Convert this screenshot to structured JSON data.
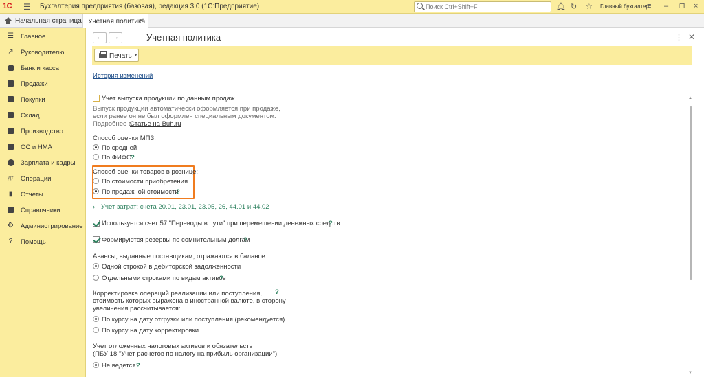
{
  "titlebar": {
    "logo": "1С",
    "app_title": "Бухгалтерия предприятия (базовая), редакция 3.0  (1С:Предприятие)",
    "search_placeholder": "Поиск Ctrl+Shift+F",
    "user": "Главный бухгалтер"
  },
  "tabs": {
    "home": "Начальная страница",
    "active": "Учетная политика"
  },
  "sidebar": {
    "items": [
      {
        "label": "Главное",
        "icon": "menu-icon"
      },
      {
        "label": "Руководителю",
        "icon": "chart-icon"
      },
      {
        "label": "Банк и касса",
        "icon": "coin-icon"
      },
      {
        "label": "Продажи",
        "icon": "bag-icon"
      },
      {
        "label": "Покупки",
        "icon": "cart-icon"
      },
      {
        "label": "Склад",
        "icon": "box-icon"
      },
      {
        "label": "Производство",
        "icon": "factory-icon"
      },
      {
        "label": "ОС и НМА",
        "icon": "truck-icon"
      },
      {
        "label": "Зарплата и кадры",
        "icon": "person-icon"
      },
      {
        "label": "Операции",
        "icon": "operations-icon"
      },
      {
        "label": "Отчеты",
        "icon": "report-icon"
      },
      {
        "label": "Справочники",
        "icon": "book-icon"
      },
      {
        "label": "Администрирование",
        "icon": "gear-icon"
      },
      {
        "label": "Помощь",
        "icon": "question-icon"
      }
    ]
  },
  "main": {
    "title": "Учетная политика",
    "print_label": "Печать",
    "history_link": "История изменений",
    "production": {
      "checkbox_label": "Учет выпуска продукции по данным продаж",
      "desc1": "Выпуск продукции автоматически оформляется при продаже,",
      "desc2": "если ранее он не был оформлен специальным документом.",
      "desc3_prefix": "Подробнее в",
      "desc3_link": "Статье на Buh.ru"
    },
    "mpz": {
      "label": "Способ оценки МПЗ:",
      "opt1": "По средней",
      "opt2": "По ФИФО"
    },
    "retail": {
      "label": "Способ оценки товаров в рознице:",
      "opt1": "По стоимости приобретения",
      "opt2": "По продажной стоимости"
    },
    "costs_link": "Учет затрат: счета 20.01, 23.01, 23.05, 26, 44.01 и 44.02",
    "account57": "Используется счет 57 \"Переводы в пути\" при перемещении денежных средств",
    "reserves": "Формируются резервы по сомнительным долгам",
    "advances": {
      "label": "Авансы, выданные поставщикам, отражаются в балансе:",
      "opt1": "Одной строкой в дебиторской задолженности",
      "opt2": "Отдельными строками по видам активов"
    },
    "correction": {
      "line1": "Корректировка операций реализации или поступления,",
      "line2": "стоимость которых выражена в иностранной валюте, в сторону",
      "line3": "увеличения рассчитывается:",
      "opt1": "По курсу на дату отгрузки или поступления (рекомендуется)",
      "opt2": "По курсу на дату корректировки"
    },
    "deferred": {
      "line1": "Учет отложенных налоговых активов и обязательств",
      "line2": "(ПБУ 18 \"Учет расчетов по налогу на прибыль организации\"):",
      "opt1": "Не ведется"
    },
    "help": "?"
  },
  "colors": {
    "accent_yellow": "#fbed9e",
    "highlight_orange": "#f07c1f",
    "link_green": "#2a7f5c"
  }
}
